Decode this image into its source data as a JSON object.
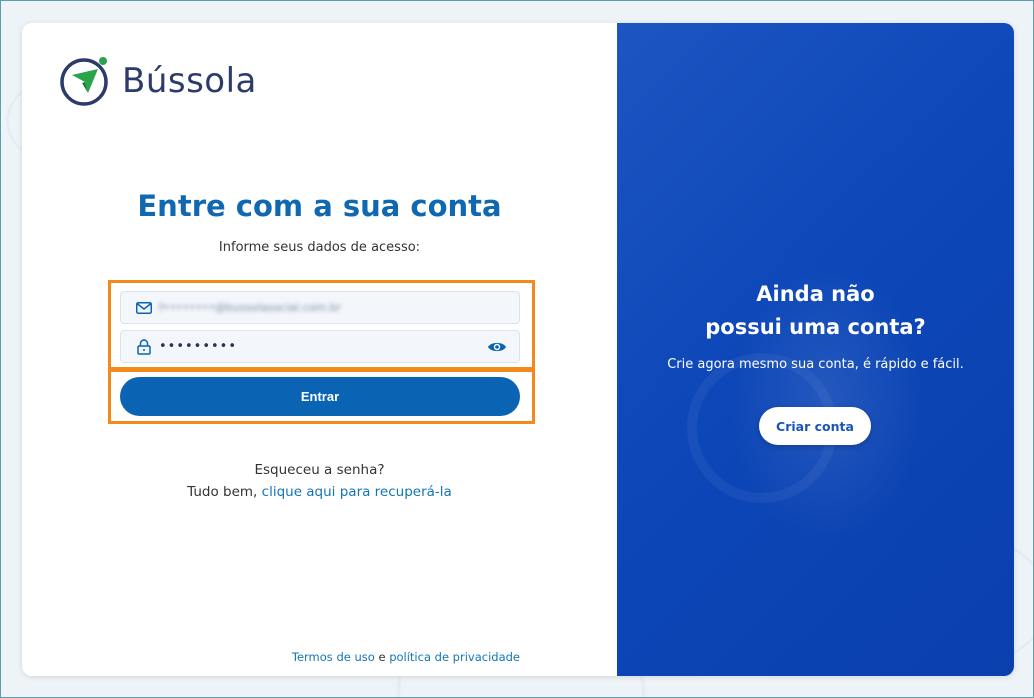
{
  "brand": {
    "name": "Bússola"
  },
  "login": {
    "title": "Entre com a sua conta",
    "subtitle": "Informe seus dados de acesso:",
    "email_value": "f••••••••@bussolasocial.com.br",
    "password_value": "•••••••••",
    "submit_label": "Entrar",
    "forgot_line1": "Esqueceu a senha?",
    "forgot_prefix": "Tudo bem, ",
    "forgot_link": "clique aqui para recuperá-la"
  },
  "footer": {
    "terms": "Termos de uso",
    "conj": " e ",
    "privacy": "política de privacidade"
  },
  "signup": {
    "title_line1": "Ainda não",
    "title_line2": "possui uma conta?",
    "subtitle": "Crie agora mesmo sua conta, é rápido e fácil.",
    "button_label": "Criar conta"
  },
  "colors": {
    "primary": "#0b63b4",
    "title_blue": "#1068b0",
    "panel_blue": "#0d47b8",
    "highlight_orange": "#f28a1c",
    "logo_green": "#2aa44a"
  },
  "icons": {
    "email": "envelope-icon",
    "password": "lock-icon",
    "toggle_password": "eye-icon"
  }
}
